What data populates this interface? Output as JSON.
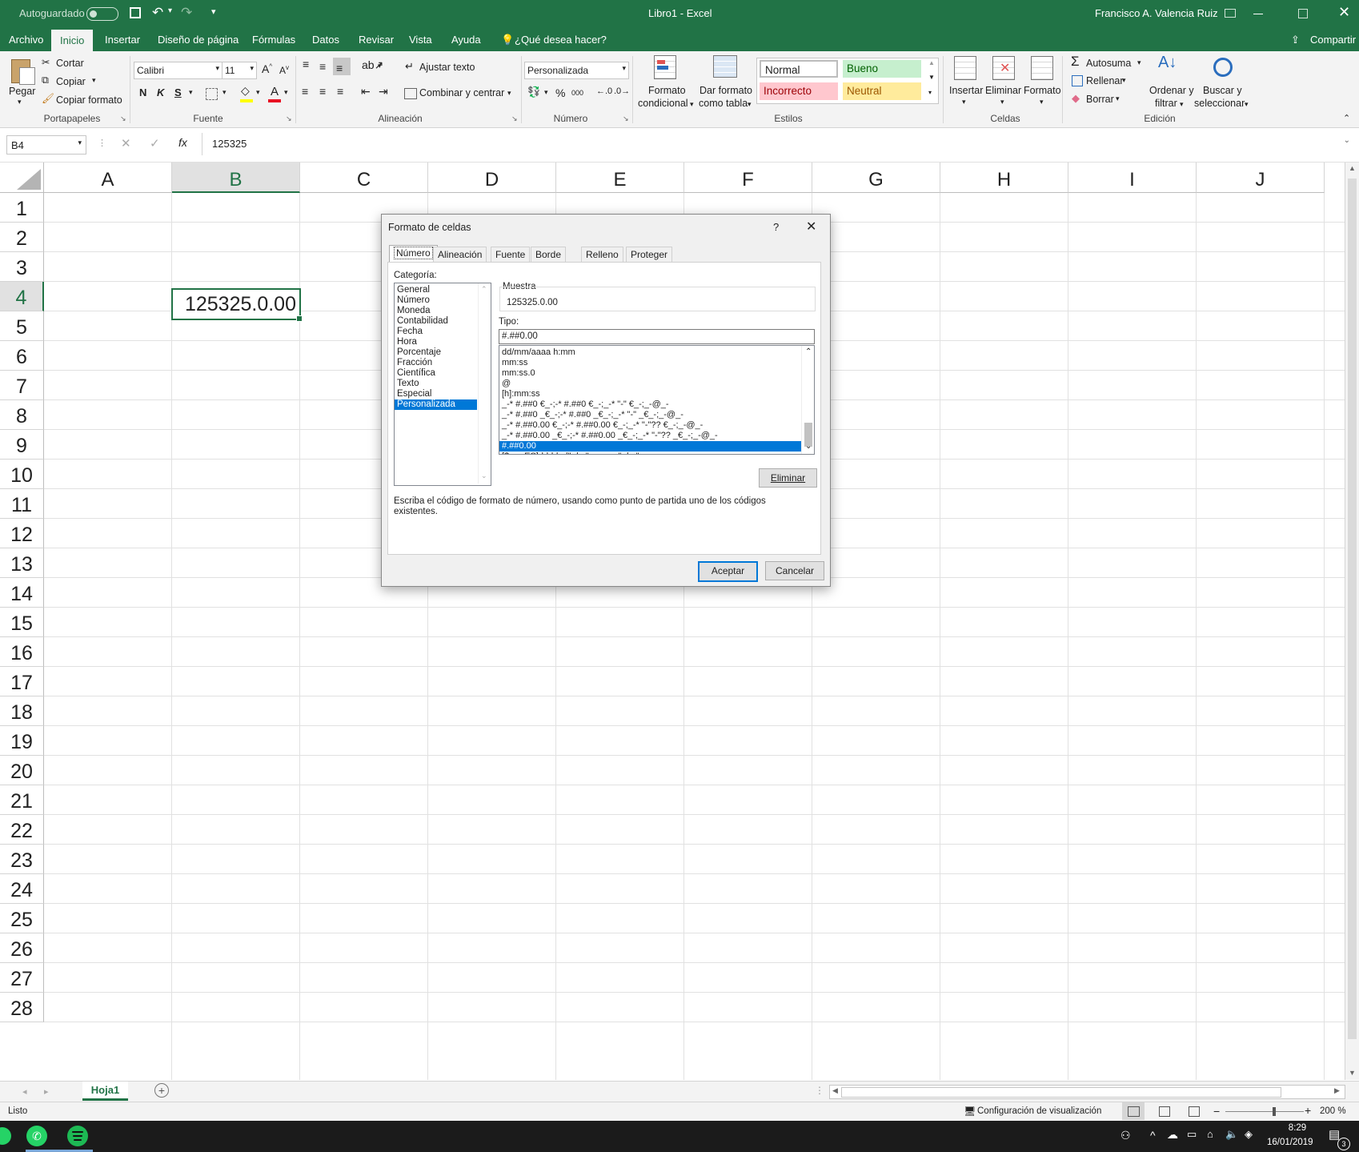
{
  "title_bar": {
    "autosave_label": "Autoguardado",
    "doc_title": "Libro1  -  Excel",
    "user": "Francisco A. Valencia Ruiz"
  },
  "ribbon_tabs": [
    "Archivo",
    "Inicio",
    "Insertar",
    "Diseño de página",
    "Fórmulas",
    "Datos",
    "Revisar",
    "Vista",
    "Ayuda"
  ],
  "tell_me": "¿Qué desea hacer?",
  "share": "Compartir",
  "ribbon": {
    "clipboard": {
      "paste": "Pegar",
      "cut": "Cortar",
      "copy": "Copiar",
      "format_painter": "Copiar formato",
      "label": "Portapapeles"
    },
    "font": {
      "name": "Calibri",
      "size": "11",
      "bold": "N",
      "italic": "K",
      "underline": "S",
      "label": "Fuente"
    },
    "alignment": {
      "wrap": "Ajustar texto",
      "merge": "Combinar y centrar",
      "label": "Alineación"
    },
    "number": {
      "format": "Personalizada",
      "percent": "%",
      "thousands": "000",
      "label": "Número"
    },
    "styles": {
      "cond_format_1": "Formato",
      "cond_format_2": "condicional",
      "table_1": "Dar formato",
      "table_2": "como tabla",
      "normal": "Normal",
      "bueno": "Bueno",
      "incorrecto": "Incorrecto",
      "neutral": "Neutral",
      "label": "Estilos"
    },
    "cells": {
      "insert": "Insertar",
      "delete": "Eliminar",
      "format": "Formato",
      "label": "Celdas"
    },
    "editing": {
      "autosum": "Autosuma",
      "fill": "Rellenar",
      "clear": "Borrar",
      "sort_1": "Ordenar y",
      "sort_2": "filtrar",
      "find_1": "Buscar y",
      "find_2": "seleccionar",
      "label": "Edición"
    }
  },
  "formula_bar": {
    "name_box": "B4",
    "fx": "fx",
    "value": "125325"
  },
  "columns": [
    "A",
    "B",
    "C",
    "D",
    "E",
    "F",
    "G",
    "H",
    "I",
    "J"
  ],
  "rows": [
    "1",
    "2",
    "3",
    "4",
    "5",
    "6",
    "7",
    "8",
    "9",
    "10",
    "11",
    "12",
    "13",
    "14",
    "15",
    "16",
    "17",
    "18",
    "19",
    "20",
    "21",
    "22",
    "23",
    "24",
    "25",
    "26",
    "27",
    "28"
  ],
  "cell_b4": "125325.0.00",
  "dialog": {
    "title": "Formato de celdas",
    "help": "?",
    "tabs": [
      "Número",
      "Alineación",
      "Fuente",
      "Borde",
      "Relleno",
      "Proteger"
    ],
    "category_label": "Categoría:",
    "categories": [
      "General",
      "Número",
      "Moneda",
      "Contabilidad",
      "Fecha",
      "Hora",
      "Porcentaje",
      "Fracción",
      "Científica",
      "Texto",
      "Especial",
      "Personalizada"
    ],
    "selected_category": "Personalizada",
    "sample_label": "Muestra",
    "sample_value": "125325.0.00",
    "type_label": "Tipo:",
    "type_value": "#.##0.00",
    "type_list": [
      "dd/mm/aaaa h:mm",
      "mm:ss",
      "mm:ss.0",
      "@",
      "[h]:mm:ss",
      "_-* #.##0 €_-;-* #.##0 €_-;_-* \"-\" €_-;_-@_-",
      "_-* #.##0 _€_-;-* #.##0 _€_-;_-* \"-\" _€_-;_-@_-",
      "_-* #.##0.00 €_-;-* #.##0.00 €_-;_-* \"-\"?? €_-;_-@_-",
      "_-* #.##0.00 _€_-;-* #.##0.00 _€_-;_-* \"-\"?? _€_-;_-@_-",
      "#.##0.00",
      "[$-es-ES]dddd, d\" de \"mmmm\" de \"aaaa"
    ],
    "selected_type": "#.##0.00",
    "delete_btn": "Eliminar",
    "help_text": "Escriba el código de formato de número, usando como punto de partida uno de los códigos existentes.",
    "ok": "Aceptar",
    "cancel": "Cancelar"
  },
  "sheet_tab": "Hoja1",
  "status": {
    "ready": "Listo",
    "display_settings": "Configuración de visualización",
    "zoom": "200 %"
  },
  "taskbar": {
    "time": "8:29",
    "date": "16/01/2019",
    "notif_count": "3"
  },
  "colors": {
    "excel_green": "#217346",
    "selection_blue": "#0078d7"
  }
}
